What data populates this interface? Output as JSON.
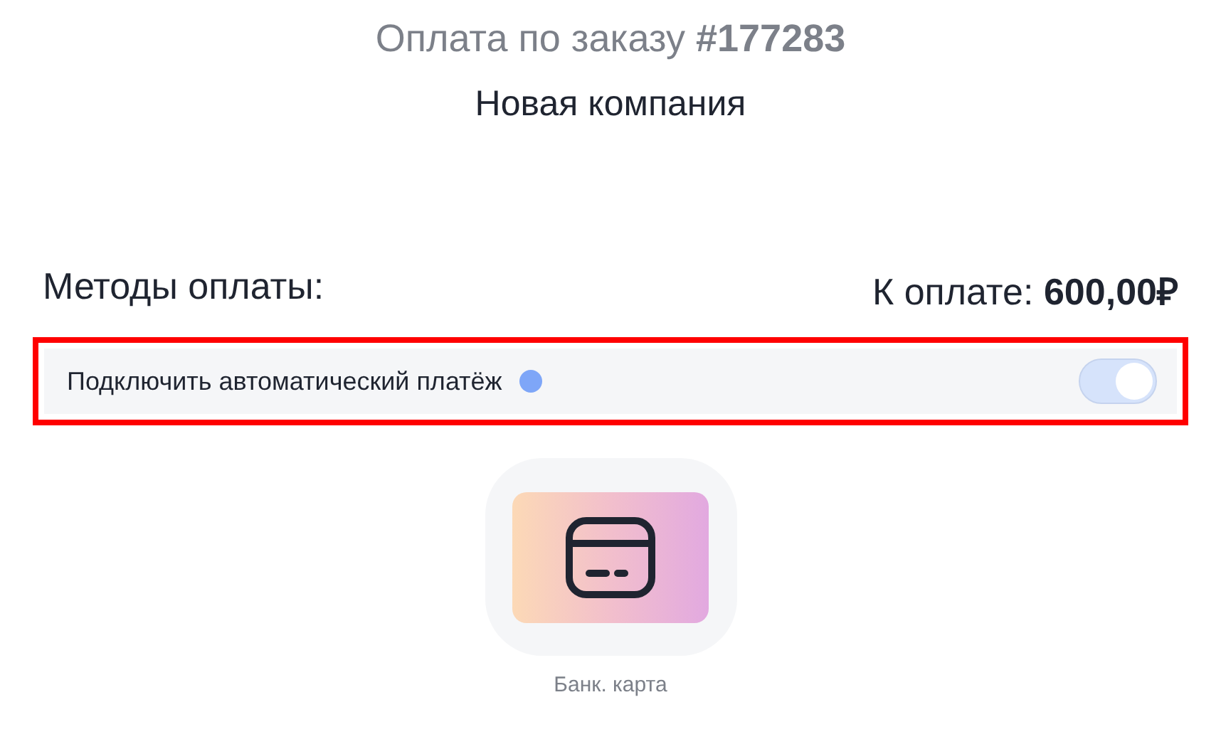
{
  "header": {
    "title": "Оплата по заказу **#177283**",
    "subtitle": "Новая компания"
  },
  "payment": {
    "methods_label": "Методы оплаты:",
    "amount": "К оплате: **600,00₽**"
  },
  "autopay": {
    "label": "Подключить автоматический платёж",
    "highlighted": true,
    "on": true
  },
  "methods": [
    {
      "label": "Банк. карта",
      "selected": false
    }
  ]
}
